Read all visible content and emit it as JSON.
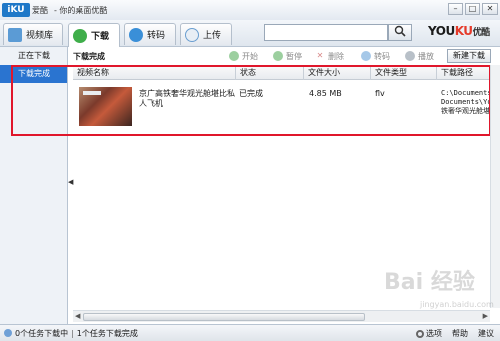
{
  "titlebar": {
    "logo": "iKU",
    "logo_sub": "爱酷",
    "title": "- 你的桌面优酷",
    "btn_min": "–",
    "btn_max": "□",
    "btn_close": "✕"
  },
  "nav": {
    "tabs": [
      {
        "label": "视频库",
        "icon": "library-icon"
      },
      {
        "label": "下载",
        "icon": "download-icon"
      },
      {
        "label": "转码",
        "icon": "transcode-icon"
      },
      {
        "label": "上传",
        "icon": "upload-icon"
      }
    ],
    "search_value": "",
    "search_icon": "search-icon",
    "brand": {
      "part1": "YOU",
      "part2": "KU",
      "part3": "优酷"
    }
  },
  "sidebar": {
    "items": [
      {
        "label": "正在下载"
      },
      {
        "label": "下载完成"
      }
    ]
  },
  "toolbar": {
    "section_title": "下载完成",
    "buttons": {
      "start": "开始",
      "pause": "暂停",
      "delete": "删除",
      "transcode": "转码",
      "play": "播放"
    },
    "new_download": "新建下载"
  },
  "table": {
    "columns": [
      "视频名称",
      "状态",
      "文件大小",
      "文件类型",
      "下载路径"
    ],
    "rows": [
      {
        "name": "京广高铁奢华观光舱堪比私人飞机",
        "status": "已完成",
        "size": "4.85 MB",
        "type": "flv",
        "path": "C:\\Documents\nDocuments\\You\n铁奢华观光舱堪"
      }
    ]
  },
  "statusbar": {
    "downloading": "0个任务下载中",
    "completed": "1个任务下载完成",
    "options": "选项",
    "help": "帮助",
    "feedback": "建议"
  },
  "watermark": {
    "text": "Bai 经验",
    "url": "jingyan.baidu.com"
  },
  "colors": {
    "accent": "#2a74d0",
    "highlight_border": "#e0162b",
    "brand_red": "#e53a2a"
  }
}
